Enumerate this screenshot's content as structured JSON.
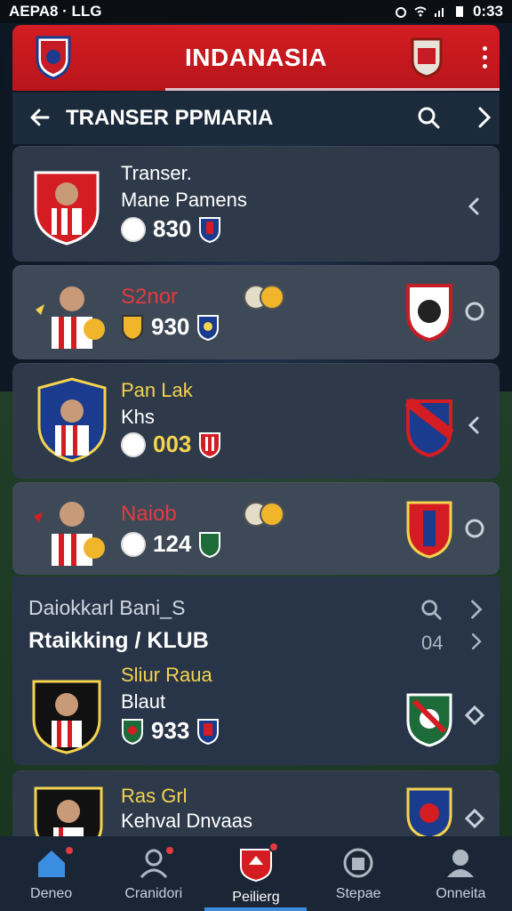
{
  "status": {
    "left": "AEPA8 · LLG",
    "time": "0:33"
  },
  "app": {
    "title": "INDANASIA"
  },
  "subheader": {
    "title": "TRANSER PPMARIA"
  },
  "cards": [
    {
      "line1": "Transer.",
      "line2": "Mane Pamens",
      "stat": "830",
      "action": "chevron-left-icon"
    },
    {
      "line1": "S2nor",
      "line2": "",
      "stat": "930",
      "action": "circle-icon"
    },
    {
      "line1": "Pan Lak",
      "line2": "Khs",
      "stat": "003",
      "action": "chevron-left-icon"
    },
    {
      "line1": "Naiob",
      "line2": "",
      "stat": "124",
      "action": "circle-icon"
    }
  ],
  "ranking": {
    "subtitle": "Daiokkarl Bani_S",
    "title": "Rtaikking / KLUB",
    "count": "04",
    "player": {
      "line1": "Sliur Raua",
      "line2": "Blaut",
      "stat": "933"
    }
  },
  "last_card": {
    "line1": "Ras Grl",
    "line2": "Kehval Dnvaas"
  },
  "tabs": [
    {
      "label": "Deneo",
      "icon": "home-icon"
    },
    {
      "label": "Cranidori",
      "icon": "user-icon"
    },
    {
      "label": "Peilierg",
      "icon": "shield-icon"
    },
    {
      "label": "Stepae",
      "icon": "jersey-icon"
    },
    {
      "label": "Onneita",
      "icon": "profile-icon"
    }
  ],
  "colors": {
    "brand_red": "#d31d22",
    "accent_blue": "#3a8de0",
    "name_yellow": "#f4d34f",
    "name_red": "#e23b40"
  }
}
